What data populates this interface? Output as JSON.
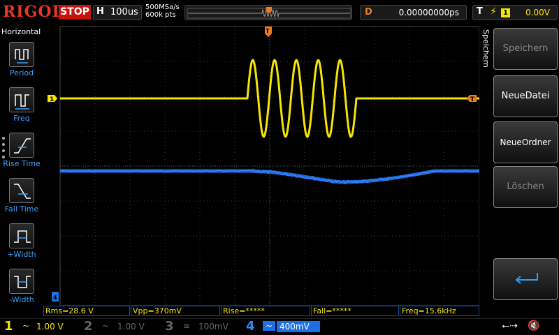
{
  "topbar": {
    "brand": "RIGOL",
    "run_state": "STOP",
    "horizontal_tag": "H",
    "timebase": "100us",
    "sample_rate": "500MSa/s",
    "memory_depth": "600k pts",
    "delay_tag": "D",
    "delay": "0.00000000ps",
    "trigger_tag": "T",
    "trigger_source": "1",
    "trigger_level": "0.00V"
  },
  "left_menu": {
    "title": "Horizontal",
    "items": [
      {
        "label": "Period",
        "icon": "period-icon"
      },
      {
        "label": "Freq",
        "icon": "frequency-icon"
      },
      {
        "label": "Rise Time",
        "icon": "rise-time-icon"
      },
      {
        "label": "Fall Time",
        "icon": "fall-time-icon"
      },
      {
        "label": "+Width",
        "icon": "positive-width-icon"
      },
      {
        "label": "-Width",
        "icon": "negative-width-icon"
      }
    ]
  },
  "right_menu": {
    "title": "Speichern",
    "buttons": [
      {
        "label": "Speichern",
        "enabled": false
      },
      {
        "label": "NeueDatei",
        "enabled": true
      },
      {
        "label": "NeueOrdner",
        "enabled": true
      },
      {
        "label": "Löschen",
        "enabled": false
      }
    ],
    "back_icon": "return-arrow-icon"
  },
  "screen": {
    "ch1_marker": "1",
    "trigger_position_marker": "T",
    "ch4_marker": "4"
  },
  "measurements": [
    {
      "text": "Rms=28.6 V"
    },
    {
      "text": "Vpp=370mV"
    },
    {
      "text": "Rise=*****"
    },
    {
      "text": "Fall=*****"
    },
    {
      "text": "Freq=15.6kHz"
    }
  ],
  "channels": [
    {
      "num": "1",
      "coupling": "~",
      "scale": "1.00 V",
      "color": "#f5e500",
      "active": true
    },
    {
      "num": "2",
      "coupling": "~",
      "scale": "1.00 V",
      "color": "#555555",
      "active": false
    },
    {
      "num": "3",
      "coupling": "≡",
      "scale": "100mV",
      "color": "#555555",
      "active": false
    },
    {
      "num": "4",
      "coupling": "~",
      "scale": "400mV",
      "color": "#1e6ee6",
      "active": true
    }
  ],
  "colors": {
    "ch1": "#f5e500",
    "ch4": "#1e6ee6",
    "trigger": "#f07c1c",
    "grid": "#3a3a3a"
  },
  "status_icons": [
    "usb-icon",
    "speaker-muted-icon"
  ]
}
